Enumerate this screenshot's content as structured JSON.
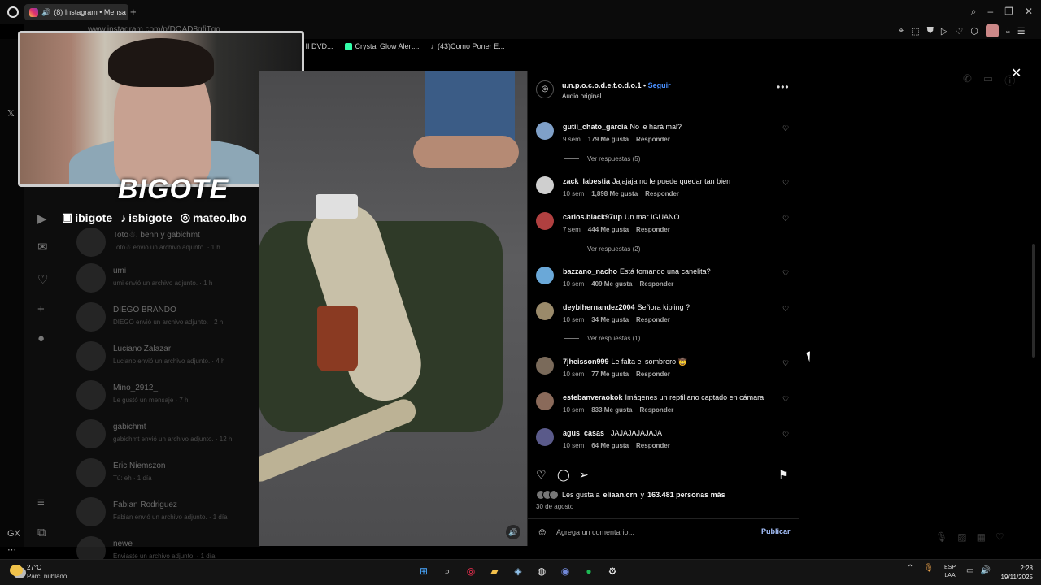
{
  "browser": {
    "tab_title": "(8) Instagram • Mensa",
    "new_tab": "+",
    "url": "www.instagram.com/p/DOAD8gfjTqo",
    "bookmarks": [
      "r II DVD...",
      "Crystal Glow Alert...",
      "(43)Como Poner E..."
    ]
  },
  "stream_overlay": {
    "brand": "BIGOTE",
    "socials": [
      "ibigote",
      "isbigote",
      "mateo.lbo"
    ]
  },
  "dm_list": [
    {
      "name": "Toto☃, benn y gabichmt",
      "preview": "Toto☃ envió un archivo adjunto. · 1 h"
    },
    {
      "name": "umi",
      "preview": "umi envió un archivo adjunto. · 1 h"
    },
    {
      "name": "DIEGO BRANDO",
      "preview": "DIEGO envió un archivo adjunto. · 2 h"
    },
    {
      "name": "Luciano Zalazar",
      "preview": "Luciano envió un archivo adjunto. · 4 h"
    },
    {
      "name": "Mino_2912_",
      "preview": "Le gustó un mensaje · 7 h"
    },
    {
      "name": "gabichmt",
      "preview": "gabichmt envió un archivo adjunto. · 12 h"
    },
    {
      "name": "Eric Niemszon",
      "preview": "Tú: eh · 1 día"
    },
    {
      "name": "Fabian Rodriguez",
      "preview": "Fabian envió un archivo adjunto. · 1 día"
    },
    {
      "name": "newe",
      "preview": "Enviaste un archivo adjunto. · 1 día"
    }
  ],
  "post": {
    "username": "u.n.p.o.c.o.d.e.t.o.d.o.1",
    "follow": "Seguir",
    "audio": "Audio original",
    "likes_prefix": "Les gusta a",
    "likes_user": "eliaan.crn",
    "likes_and": "y",
    "likes_count": "163.481 personas más",
    "date": "30 de agosto",
    "comment_placeholder": "Agrega un comentario...",
    "publish": "Publicar"
  },
  "comments": [
    {
      "user": "gutii_chato_garcia",
      "text": "No le hará mal?",
      "time": "9 sem",
      "likes": "179 Me gusta",
      "reply": "Responder",
      "replies": "Ver respuestas (5)",
      "color": "#7fa0c8"
    },
    {
      "user": "zack_labestia",
      "text": "Jajajaja no le puede quedar tan bien",
      "time": "10 sem",
      "likes": "1,898 Me gusta",
      "reply": "Responder",
      "replies": "",
      "color": "#cfcfcf"
    },
    {
      "user": "carlos.black97up",
      "text": "Un mar IGUANO",
      "time": "7 sem",
      "likes": "444 Me gusta",
      "reply": "Responder",
      "replies": "Ver respuestas (2)",
      "color": "#b04040"
    },
    {
      "user": "bazzano_nacho",
      "text": "Está tomando una canelita?",
      "time": "10 sem",
      "likes": "409 Me gusta",
      "reply": "Responder",
      "replies": "",
      "color": "#6aa8d8"
    },
    {
      "user": "deybihernandez2004",
      "text": "Señora kipling ?",
      "time": "10 sem",
      "likes": "34 Me gusta",
      "reply": "Responder",
      "replies": "Ver respuestas (1)",
      "color": "#9a8a6a"
    },
    {
      "user": "7jheisson999",
      "text": "Le falta el sombrero 🤠",
      "time": "10 sem",
      "likes": "77 Me gusta",
      "reply": "Responder",
      "replies": "",
      "color": "#7a6a5a"
    },
    {
      "user": "estebanveraokok",
      "text": "Imágenes un reptiliano captado en cámara",
      "time": "10 sem",
      "likes": "833 Me gusta",
      "reply": "Responder",
      "replies": "",
      "color": "#8a6a5a"
    },
    {
      "user": "agus_casas_",
      "text": "JAJAJAJAJAJA",
      "time": "10 sem",
      "likes": "64 Me gusta",
      "reply": "Responder",
      "replies": "",
      "color": "#5a5a8a"
    }
  ],
  "taskbar": {
    "temp": "27°C",
    "weather": "Parc. nublado",
    "lang_top": "ESP",
    "lang_bottom": "LAA",
    "time": "2:28",
    "date": "19/11/2025",
    "sidebar_label": "GX"
  }
}
